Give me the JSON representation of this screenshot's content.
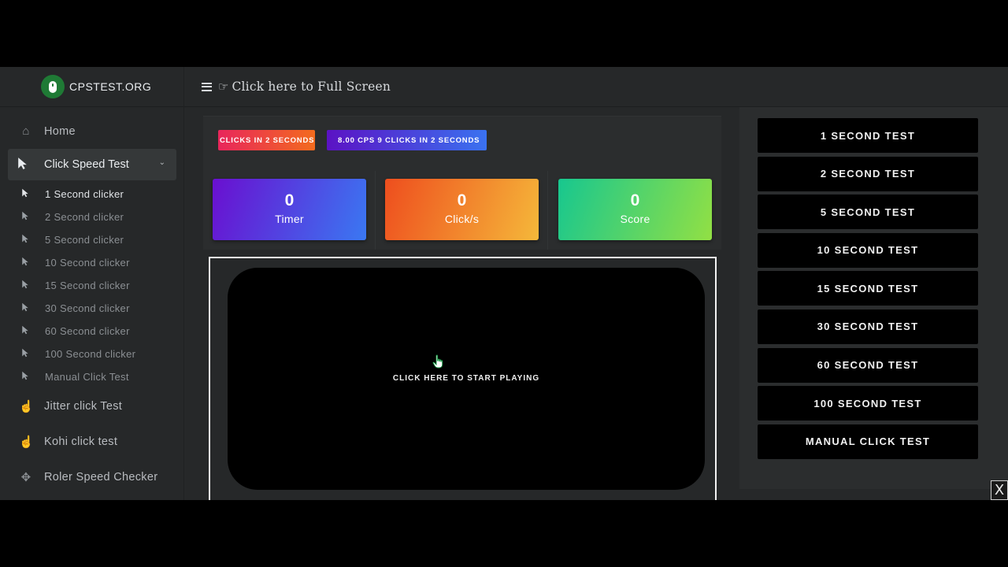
{
  "brand": {
    "name": "CPSTEST.ORG"
  },
  "header": {
    "fullscreen_label": "Click here to Full Screen"
  },
  "sidebar": {
    "home": "Home",
    "click_speed": "Click Speed Test",
    "sub": [
      "1 Second clicker",
      "2 Second clicker",
      "5 Second clicker",
      "10 Second clicker",
      "15 Second clicker",
      "30 Second clicker",
      "60 Second clicker",
      "100 Second clicker",
      "Manual Click Test"
    ],
    "jitter": "Jitter click Test",
    "kohi": "Kohi click test",
    "roler": "Roler Speed Checker"
  },
  "ticker": {
    "a": "CLICKS IN 2 SECONDS",
    "b": "8.00 CPS 9 CLICKS IN 2 SECONDS"
  },
  "stats": {
    "timer_value": "0",
    "timer_label": "Timer",
    "cps_value": "0",
    "cps_label": "Click/s",
    "score_value": "0",
    "score_label": "Score"
  },
  "play": {
    "label": "CLICK HERE TO START PLAYING"
  },
  "tests": [
    "1 SECOND TEST",
    "2 SECOND TEST",
    "5 SECOND TEST",
    "10 SECOND TEST",
    "15 SECOND TEST",
    "30 SECOND TEST",
    "60 SECOND TEST",
    "100 SECOND TEST",
    "MANUAL CLICK TEST"
  ],
  "close_label": "X"
}
